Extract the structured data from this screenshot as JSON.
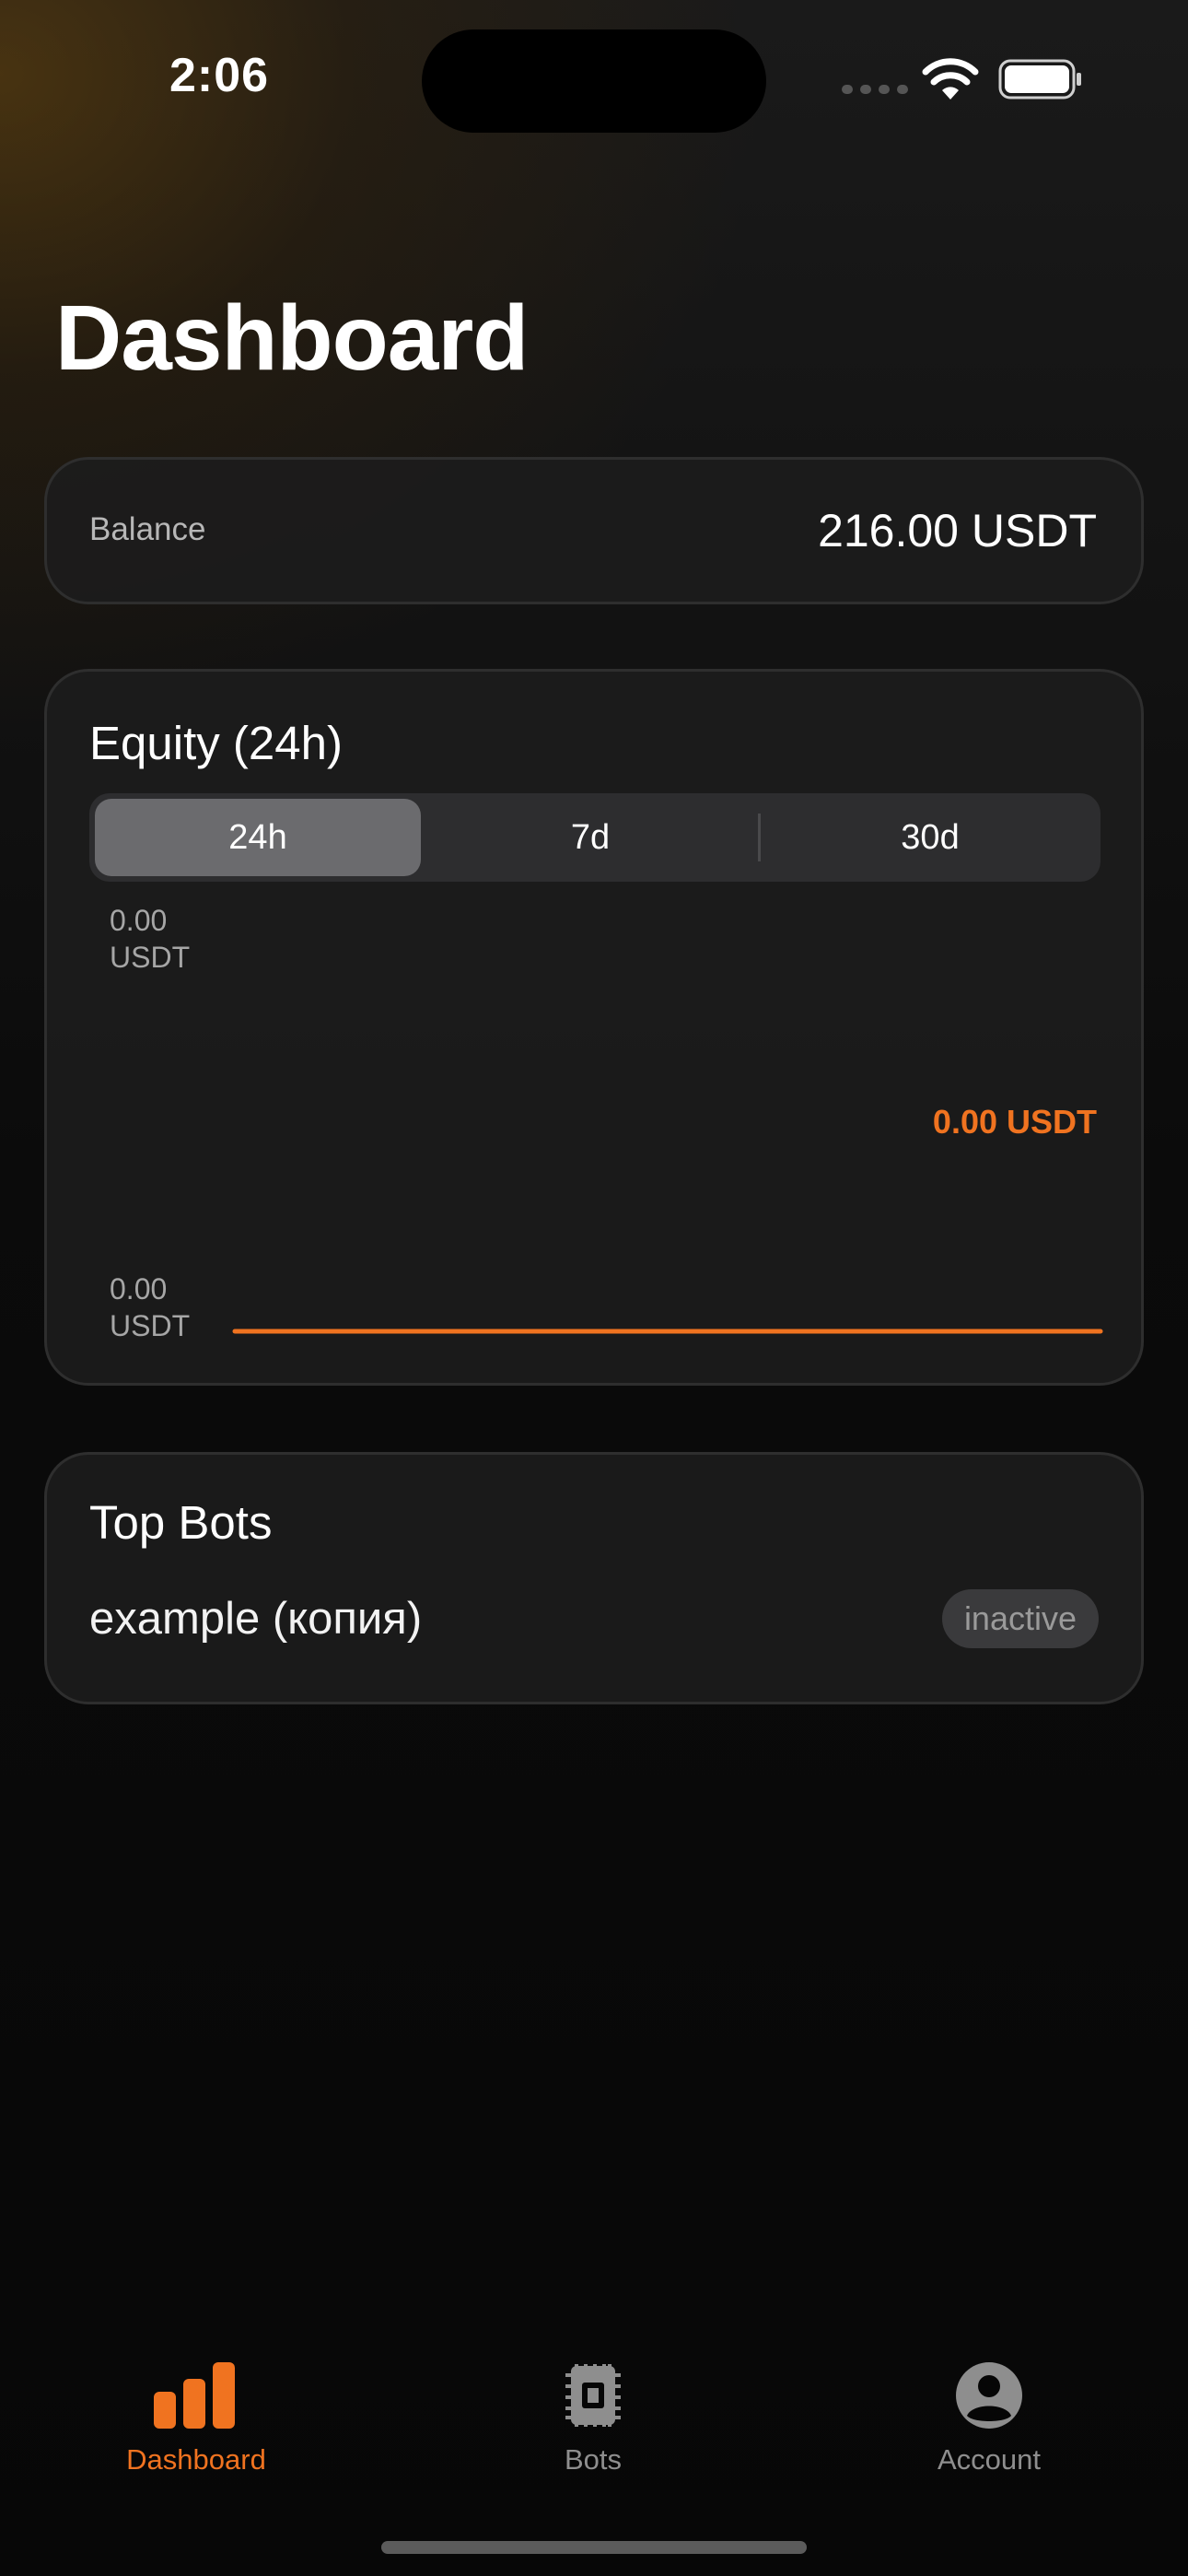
{
  "status_bar": {
    "time": "2:06"
  },
  "page": {
    "title": "Dashboard"
  },
  "balance": {
    "label": "Balance",
    "value": "216.00 USDT"
  },
  "equity": {
    "title": "Equity (24h)",
    "ranges": [
      "24h",
      "7d",
      "30d"
    ],
    "selected_range": "24h",
    "axis_top": [
      "0.00",
      "USDT"
    ],
    "axis_bottom": [
      "0.00",
      "USDT"
    ],
    "current_value": "0.00 USDT",
    "accent_color": "#f07320"
  },
  "chart_data": {
    "type": "line",
    "title": "Equity (24h)",
    "series": [
      {
        "values": [
          0.0,
          0.0
        ]
      }
    ],
    "ylim": [
      0.0,
      0.0
    ],
    "ytick_labels": [
      "0.00 USDT",
      "0.00 USDT"
    ],
    "grid": false
  },
  "top_bots": {
    "title": "Top Bots",
    "items": [
      {
        "name": "example (копия)",
        "status": "inactive"
      }
    ]
  },
  "tab_bar": {
    "items": [
      {
        "label": "Dashboard",
        "icon": "bar-chart-icon",
        "active": true
      },
      {
        "label": "Bots",
        "icon": "chip-icon",
        "active": false
      },
      {
        "label": "Account",
        "icon": "person-circle-icon",
        "active": false
      }
    ]
  }
}
